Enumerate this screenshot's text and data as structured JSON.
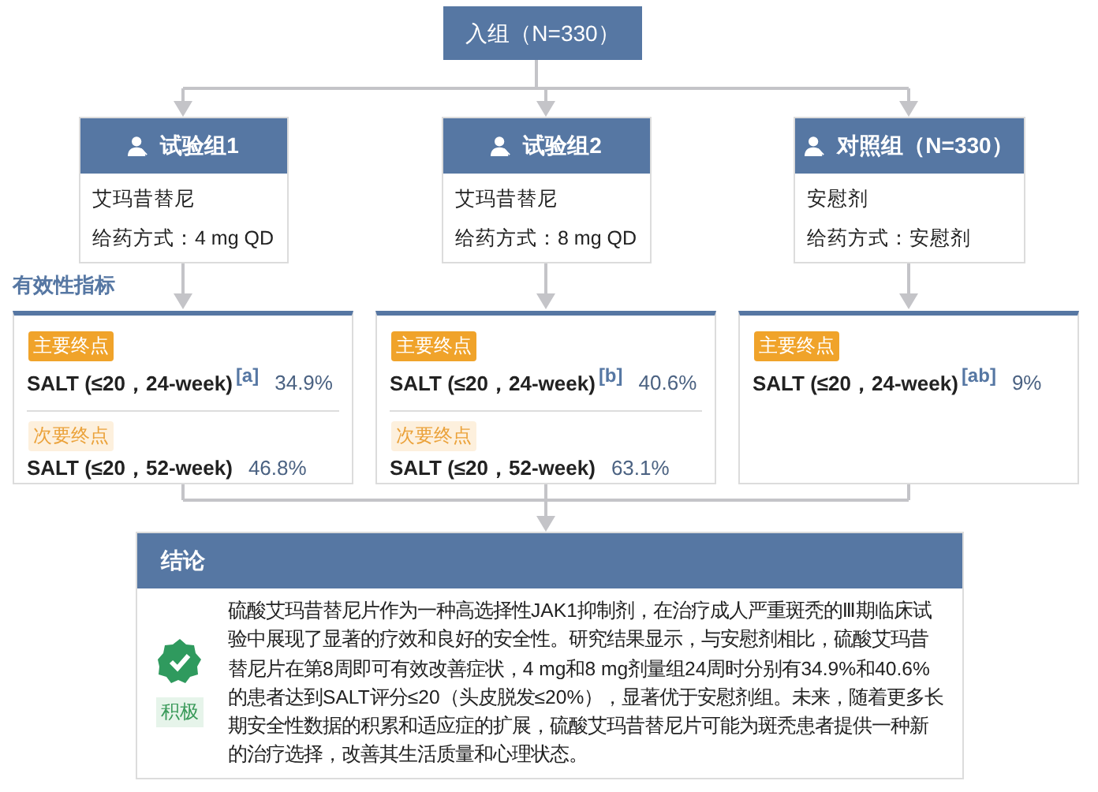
{
  "entry": {
    "label": "入组（N=330）"
  },
  "groups": [
    {
      "title": "试验组1",
      "drug": "艾玛昔替尼",
      "dosing": "给药方式：4 mg QD"
    },
    {
      "title": "试验组2",
      "drug": "艾玛昔替尼",
      "dosing": "给药方式：8 mg QD"
    },
    {
      "title": "对照组（N=330）",
      "drug": "安慰剂",
      "dosing": "给药方式：安慰剂"
    }
  ],
  "efficacy_label": "有效性指标",
  "endpoint_cards": [
    {
      "endpoints": [
        {
          "kind": "primary",
          "tag": "主要终点",
          "metric": "SALT (≤20，24-week)",
          "note": "[a]",
          "value": "34.9%"
        },
        {
          "kind": "secondary",
          "tag": "次要终点",
          "metric": "SALT (≤20，52-week)",
          "value": "46.8%"
        }
      ]
    },
    {
      "endpoints": [
        {
          "kind": "primary",
          "tag": "主要终点",
          "metric": "SALT (≤20，24-week)",
          "note": "[b]",
          "value": "40.6%"
        },
        {
          "kind": "secondary",
          "tag": "次要终点",
          "metric": "SALT (≤20，52-week)",
          "value": "63.1%"
        }
      ]
    },
    {
      "endpoints": [
        {
          "kind": "primary",
          "tag": "主要终点",
          "metric": "SALT (≤20，24-week)",
          "note": "[ab]",
          "value": "9%"
        }
      ]
    }
  ],
  "conclusion": {
    "title": "结论",
    "verdict": "积极",
    "text": "硫酸艾玛昔替尼片作为一种高选择性JAK1抑制剂，在治疗成人严重斑秃的Ⅲ期临床试验中展现了显著的疗效和良好的安全性。研究结果显示，与安慰剂相比，硫酸艾玛昔替尼片在第8周即可有效改善症状，4 mg和8 mg剂量组24周时分别有34.9%和40.6%的患者达到SALT评分≤20（头皮脱发≤20%），显著优于安慰剂组。未来，随着更多长期安全性数据的积累和适应症的扩展，硫酸艾玛昔替尼片可能为斑秃患者提供一种新的治疗选择，改善其生活质量和心理状态。"
  }
}
